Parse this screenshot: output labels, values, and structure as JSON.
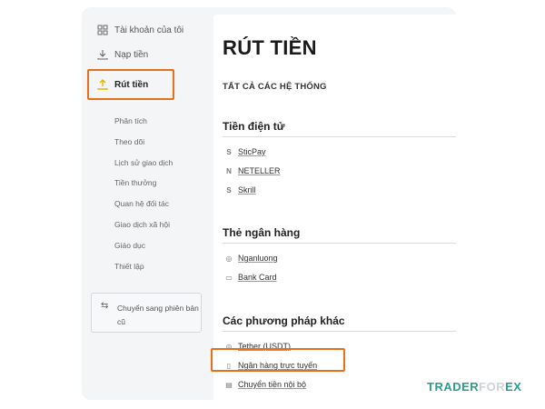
{
  "sidebar": {
    "main_items": [
      {
        "label": "Tài khoản của tôi",
        "icon": "grid-icon"
      },
      {
        "label": "Nạp tiền",
        "icon": "download-icon"
      },
      {
        "label": "Rút tiền",
        "icon": "withdraw-icon",
        "active": true
      }
    ],
    "sub_items": [
      "Phân tích",
      "Theo dõi",
      "Lịch sử giao dịch",
      "Tiền thưởng",
      "Quan hệ đối tác",
      "Giao dịch xã hội",
      "Giáo dục",
      "Thiết lập"
    ],
    "switch_label": "Chuyển sang phiên bản cũ"
  },
  "main": {
    "title": "RÚT TIỀN",
    "all_systems": "TẤT CẢ CÁC HỆ THỐNG",
    "sections": [
      {
        "title": "Tiền điện tử",
        "methods": [
          {
            "label": "SticPay",
            "icon": "sticpay-icon",
            "glyph": "S"
          },
          {
            "label": "NETELLER",
            "icon": "neteller-icon",
            "glyph": "N"
          },
          {
            "label": "Skrill",
            "icon": "skrill-icon",
            "glyph": "S"
          }
        ]
      },
      {
        "title": "Thẻ ngân hàng",
        "methods": [
          {
            "label": "Nganluong",
            "icon": "nganluong-icon",
            "glyph": "◎"
          },
          {
            "label": "Bank Card",
            "icon": "card-icon",
            "glyph": "▭"
          }
        ]
      },
      {
        "title": "Các phương pháp khác",
        "methods": [
          {
            "label": "Tether (USDT)",
            "icon": "tether-icon",
            "glyph": "◎"
          },
          {
            "label": "Ngân hàng trực tuyến",
            "icon": "online-bank-icon",
            "glyph": "▯"
          },
          {
            "label": "Chuyển tiền nội bộ",
            "icon": "transfer-icon",
            "glyph": "▤"
          }
        ]
      }
    ]
  },
  "watermark": {
    "part1": "TRADER",
    "part2": "FOR",
    "part3": "EX"
  },
  "colors": {
    "highlight": "#e8701a",
    "accent_icon": "#e6b800",
    "watermark": "#2a9d8f"
  }
}
